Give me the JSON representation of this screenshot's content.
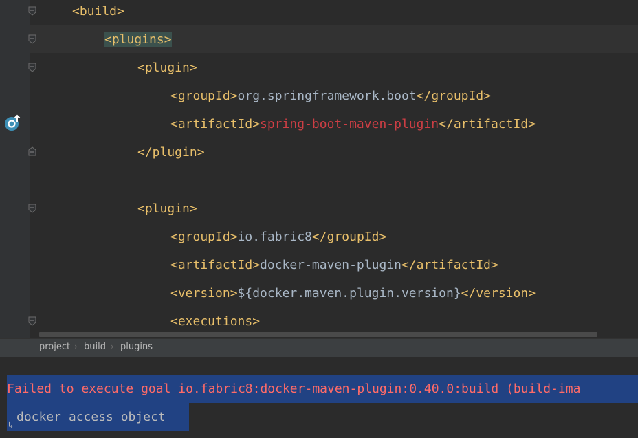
{
  "editor": {
    "lines": [
      {
        "l": "<build>"
      },
      {
        "l": "<plugins>"
      },
      {
        "l": "<plugin>"
      },
      {
        "o": "<groupId>",
        "v": "org.springframework.boot",
        "c": "</groupId>"
      },
      {
        "o": "<artifactId>",
        "v": "spring-boot-maven-plugin",
        "c": "</artifactId>"
      },
      {
        "l": "</plugin>"
      },
      {
        "l": "<plugin>"
      },
      {
        "o": "<groupId>",
        "v": "io.fabric8",
        "c": "</groupId>"
      },
      {
        "o": "<artifactId>",
        "v": "docker-maven-plugin",
        "c": "</artifactId>"
      },
      {
        "o": "<version>",
        "v": "${docker.maven.plugin.version}",
        "c": "</version>"
      },
      {
        "l": "<executions>"
      }
    ]
  },
  "breadcrumb": {
    "items": [
      "project",
      "build",
      "plugins"
    ]
  },
  "console": {
    "line1": "Failed to execute goal io.fabric8:docker-maven-plugin:0.40.0:build (build-ima",
    "line2": "docker access object"
  },
  "colors": {
    "tag": "#e8bf6a",
    "text": "#a9b7c6",
    "error": "#ff6b68",
    "selection": "#214283",
    "string_red": "#cc3e44"
  },
  "icons": [
    "fold-marker-icon",
    "run-gutter-icon",
    "soft-wrap-icon",
    "breadcrumb-chevron-icon"
  ]
}
